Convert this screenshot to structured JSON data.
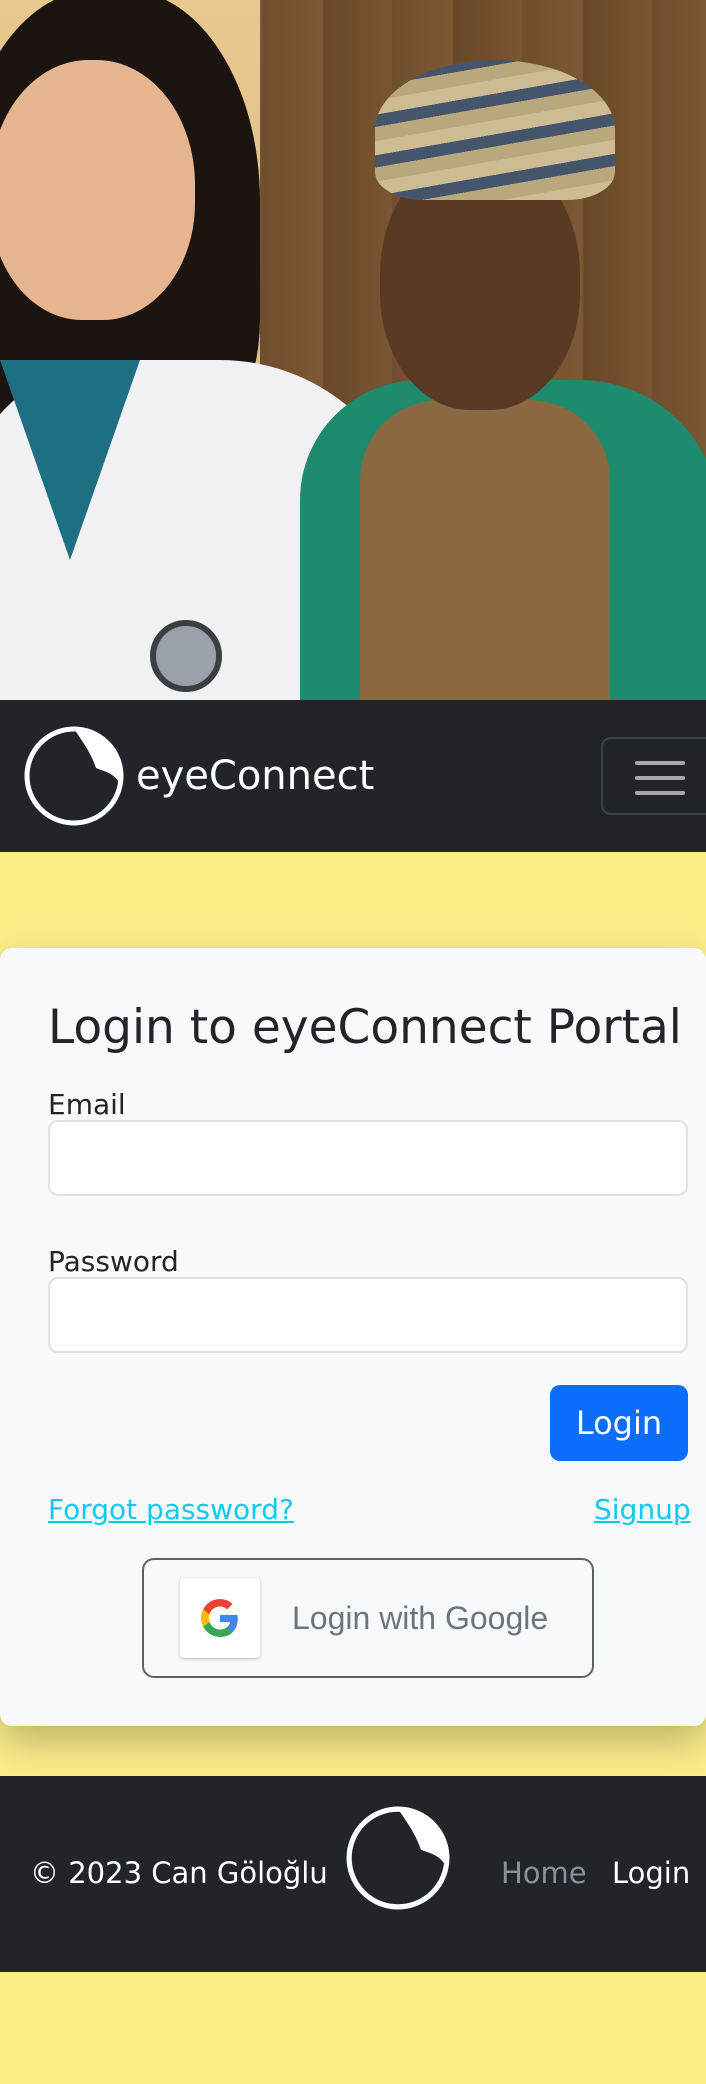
{
  "hero": {
    "alt": "Doctor and patient photo"
  },
  "navbar": {
    "brand": "eyeConnect",
    "toggler_icon": "hamburger-menu-icon"
  },
  "login": {
    "title": "Login to eyeConnect Portal",
    "email_label": "Email",
    "email_value": "",
    "password_label": "Password",
    "password_value": "",
    "submit_label": "Login",
    "forgot_label": "Forgot password?",
    "signup_label": "Signup",
    "google_label": "Login with Google",
    "google_icon": "google-g-icon"
  },
  "footer": {
    "copyright": "© 2023 Can Göloğlu",
    "nav": [
      "Home",
      "Login"
    ]
  },
  "colors": {
    "page_background": "#fdee8a",
    "navbar": "#212529",
    "primary": "#0d6efd",
    "link": "#0dcaf0",
    "card": "#f8f9fa"
  }
}
